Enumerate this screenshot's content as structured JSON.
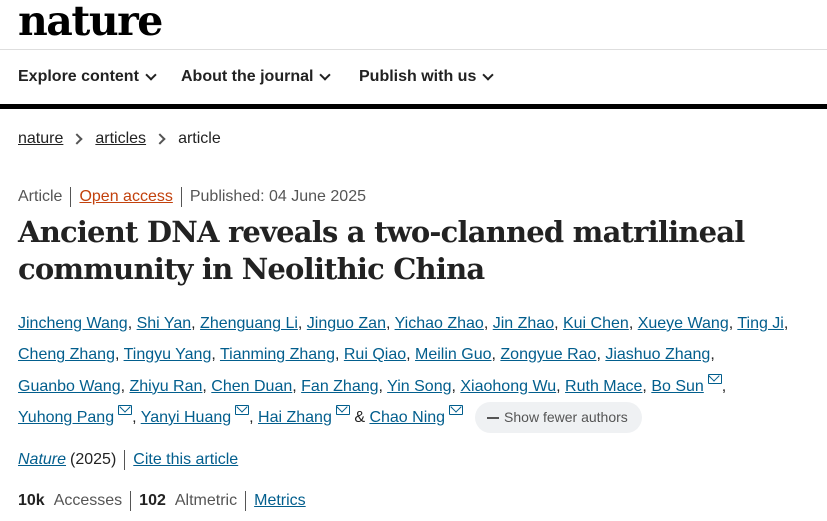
{
  "site": {
    "logo": "nature"
  },
  "nav": [
    {
      "label": "Explore content"
    },
    {
      "label": "About the journal"
    },
    {
      "label": "Publish with us"
    }
  ],
  "breadcrumb": [
    "nature",
    "articles",
    "article"
  ],
  "article": {
    "type": "Article",
    "access": "Open access",
    "published": "Published: 04 June 2025",
    "title": "Ancient DNA reveals a two-clanned matrilineal community in Neolithic China",
    "authors": [
      {
        "name": "Jincheng Wang",
        "mail": false
      },
      {
        "name": "Shi Yan",
        "mail": false
      },
      {
        "name": "Zhenguang Li",
        "mail": false
      },
      {
        "name": "Jinguo Zan",
        "mail": false
      },
      {
        "name": "Yichao Zhao",
        "mail": false
      },
      {
        "name": "Jin Zhao",
        "mail": false
      },
      {
        "name": "Kui Chen",
        "mail": false
      },
      {
        "name": "Xueye Wang",
        "mail": false
      },
      {
        "name": "Ting Ji",
        "mail": false
      },
      {
        "name": "Cheng Zhang",
        "mail": false
      },
      {
        "name": "Tingyu Yang",
        "mail": false
      },
      {
        "name": "Tianming Zhang",
        "mail": false
      },
      {
        "name": "Rui Qiao",
        "mail": false
      },
      {
        "name": "Meilin Guo",
        "mail": false
      },
      {
        "name": "Zongyue Rao",
        "mail": false
      },
      {
        "name": "Jiashuo Zhang",
        "mail": false
      },
      {
        "name": "Guanbo Wang",
        "mail": false
      },
      {
        "name": "Zhiyu Ran",
        "mail": false
      },
      {
        "name": "Chen Duan",
        "mail": false
      },
      {
        "name": "Fan Zhang",
        "mail": false
      },
      {
        "name": "Yin Song",
        "mail": false
      },
      {
        "name": "Xiaohong Wu",
        "mail": false
      },
      {
        "name": "Ruth Mace",
        "mail": false
      },
      {
        "name": "Bo Sun",
        "mail": true
      },
      {
        "name": "Yuhong Pang",
        "mail": true
      },
      {
        "name": "Yanyi Huang",
        "mail": true
      },
      {
        "name": "Hai Zhang",
        "mail": true
      },
      {
        "name": "Chao Ning",
        "mail": true
      }
    ],
    "authors_conjunction": "&",
    "show_fewer_label": "Show fewer authors",
    "journal": "Nature",
    "year": "(2025)",
    "cite_label": "Cite this article",
    "accesses_value": "10k",
    "accesses_label": "Accesses",
    "altmetric_value": "102",
    "altmetric_label": "Altmetric",
    "metrics_label": "Metrics"
  },
  "colors": {
    "link": "#025e8d",
    "open_access": "#c2410c",
    "text": "#222222",
    "muted": "#555555",
    "rule": "#000000"
  }
}
